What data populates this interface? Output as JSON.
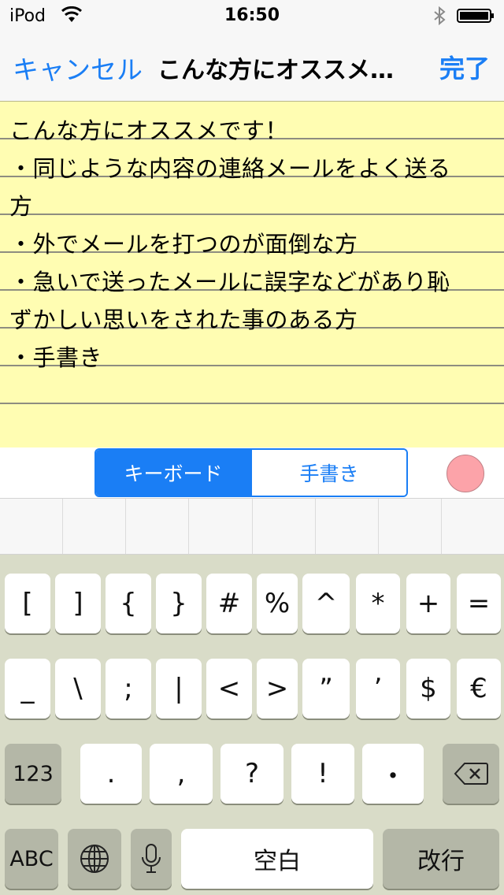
{
  "status_bar": {
    "carrier": "iPod",
    "time": "16:50"
  },
  "nav": {
    "cancel_label": "キャンセル",
    "title": "こんな方にオススメ…",
    "done_label": "完了",
    "accent_color": "#1a7ef5"
  },
  "note": {
    "background_color": "#fffdb2",
    "lines": [
      "こんな方にオススメです！",
      "・同じような内容の連絡メールをよく送る",
      "方",
      "・外でメールを打つのが面倒な方",
      "・急いで送ったメールに誤字などがあり恥",
      "ずかしい思いをされた事のある方",
      "・手書き",
      "",
      ""
    ]
  },
  "toolbar": {
    "segments": [
      "キーボード",
      "手書き"
    ],
    "selected_segment": "キーボード",
    "pen_color": "#fca3a9"
  },
  "keyboard": {
    "row1": [
      "[",
      "]",
      "{",
      "}",
      "#",
      "%",
      "^",
      "*",
      "+",
      "="
    ],
    "row2": [
      "_",
      "\\",
      ";",
      "|",
      "<",
      ">",
      "”",
      "’",
      "$",
      "€"
    ],
    "row3_mode": "123",
    "row3": [
      ".",
      ",",
      "?",
      "!",
      "・"
    ],
    "row3_delete": "delete-icon",
    "row4_abc": "ABC",
    "row4_globe": "globe-icon",
    "row4_mic": "microphone-icon",
    "space_label": "空白",
    "return_label": "改行"
  }
}
